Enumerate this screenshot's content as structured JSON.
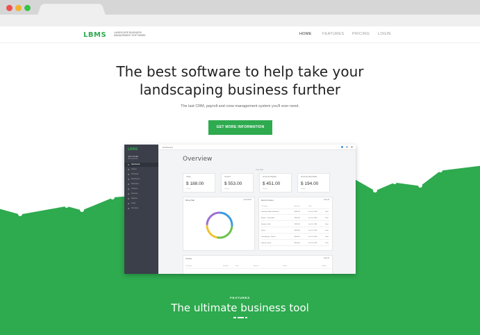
{
  "brand": {
    "logo": "LBMS",
    "tagline": "Landscape Business Management Software",
    "green": "#2eaa4f"
  },
  "nav": {
    "items": [
      "HOME",
      "FEATURES",
      "PRICING",
      "LOGIN"
    ]
  },
  "hero": {
    "title_line1": "The best software to help take your",
    "title_line2": "landscaping business further",
    "subtitle": "The last CRM, payroll and crew management system you'll ever need.",
    "cta": "GET MORE INFORMATION"
  },
  "dashboard": {
    "logo": "LBMS",
    "user": "John Smith",
    "role": "Administrator",
    "crumb": "Dashboard",
    "sidebar": [
      "Dashboard",
      "Clients",
      "Schedule",
      "Employees",
      "Estimates",
      "Invoices",
      "Services",
      "Reports",
      "Tasks",
      "Inventory"
    ],
    "title": "Overview",
    "period": "Year Total",
    "cards": [
      {
        "label": "Today",
        "value": "$ 188.00",
        "delta": "Details"
      },
      {
        "label": "Invoices",
        "value": "$ 553.00",
        "delta": "Details"
      },
      {
        "label": "Accounts Payable",
        "value": "$ 451.00",
        "delta": "Details"
      },
      {
        "label": "Accounts Receivable",
        "value": "$ 194.00",
        "delta": "Details"
      }
    ],
    "donut_panel": {
      "title": "Money Map",
      "right": "Last Month"
    },
    "activity_panel": {
      "title": "Recent Invoices",
      "right": "View All",
      "headers": [
        "Customer",
        "Amount",
        "Date",
        ""
      ],
      "rows": [
        [
          "Greenley, Wild and Boone",
          "$587.00",
          "Jan 10, 2016",
          "View"
        ],
        [
          "Brooks - Greenfield",
          "$553.00",
          "Jan 10, 2016",
          "View"
        ],
        [
          "Heartily - Hills",
          "$451.00",
          "Jan 10, 2016",
          "View"
        ],
        [
          "Fig Inc",
          "$194.00",
          "Jan 10, 2016",
          "View"
        ],
        [
          "Schneberger - Hickle",
          "$180.00",
          "Jan 10, 2016",
          "View"
        ],
        [
          "Hudson Group",
          "$154.00",
          "Jan 10, 2016",
          "View"
        ]
      ]
    },
    "bottom_panel": {
      "title": "Invoices",
      "right": "View All",
      "headers": [
        "Customer",
        "Number",
        "Date",
        "Amount",
        "Status",
        "Options"
      ]
    }
  },
  "features": {
    "label": "FEATURES",
    "title": "The ultimate business tool"
  }
}
